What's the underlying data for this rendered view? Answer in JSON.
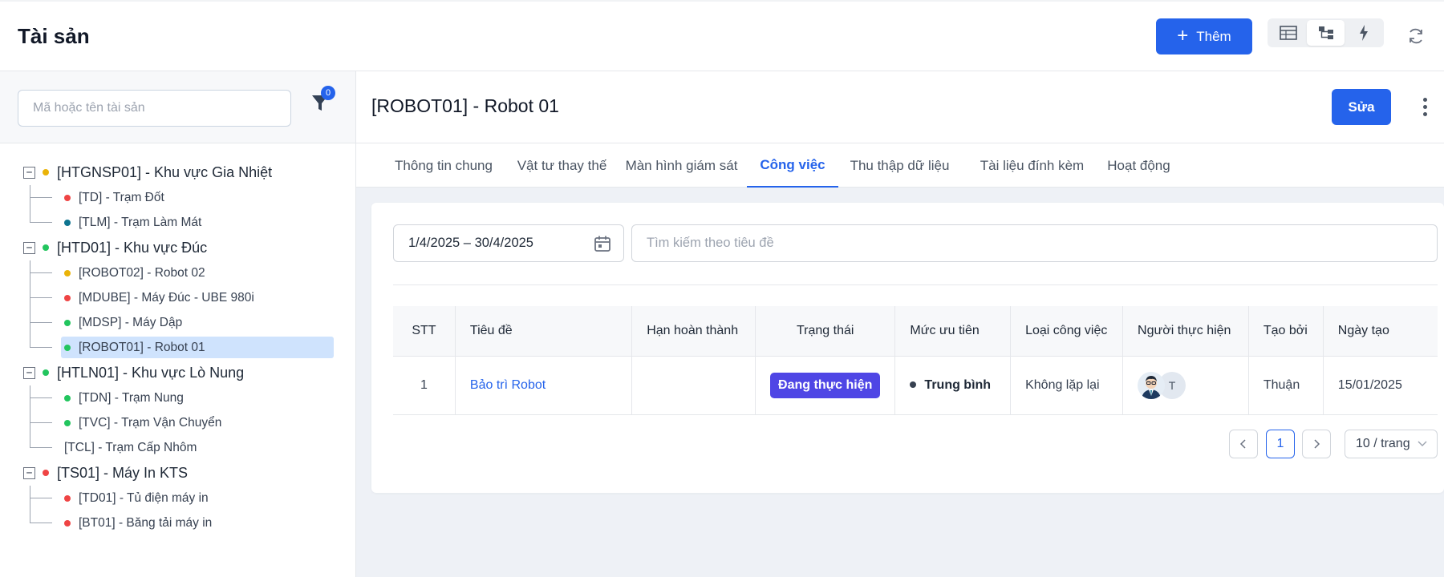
{
  "header": {
    "title": "Tài sản",
    "add_label": "Thêm",
    "view_modes": [
      "table-view-icon",
      "tree-view-icon",
      "lightning-icon"
    ]
  },
  "sidebar": {
    "search_placeholder": "Mã hoặc tên tài sản",
    "filter_count": "0",
    "tree": [
      {
        "label": "[HTGNSP01] - Khu vực Gia Nhiệt",
        "color": "#eab308",
        "children": [
          {
            "label": "[TD] - Trạm Đốt",
            "color": "#ef4444"
          },
          {
            "label": "[TLM] - Trạm Làm Mát",
            "color": "#0e7490"
          }
        ]
      },
      {
        "label": "[HTD01] - Khu vực Đúc",
        "color": "#22c55e",
        "children": [
          {
            "label": "[ROBOT02] - Robot 02",
            "color": "#eab308"
          },
          {
            "label": "[MDUBE] - Máy Đúc - UBE 980i",
            "color": "#ef4444"
          },
          {
            "label": "[MDSP] - Máy Dập",
            "color": "#22c55e"
          },
          {
            "label": "[ROBOT01] - Robot 01",
            "color": "#22c55e",
            "selected": true
          }
        ]
      },
      {
        "label": "[HTLN01] - Khu vực Lò Nung",
        "color": "#22c55e",
        "children": [
          {
            "label": "[TDN] - Trạm Nung",
            "color": "#22c55e"
          },
          {
            "label": "[TVC] - Trạm Vận Chuyển",
            "color": "#22c55e"
          },
          {
            "label": "[TCL] - Trạm Cấp Nhôm",
            "color": ""
          }
        ]
      },
      {
        "label": "[TS01] - Máy In KTS",
        "color": "#ef4444",
        "children": [
          {
            "label": "[TD01] - Tủ điện máy in",
            "color": "#ef4444"
          },
          {
            "label": "[BT01] - Băng tải máy in",
            "color": "#ef4444"
          }
        ]
      }
    ]
  },
  "detail": {
    "title": "[ROBOT01] - Robot 01",
    "edit_label": "Sửa",
    "tabs": [
      {
        "label": "Thông tin chung"
      },
      {
        "label": "Vật tư thay thế"
      },
      {
        "label": "Màn hình giám sát"
      },
      {
        "label": "Công việc",
        "active": true
      },
      {
        "label": "Thu thập dữ liệu"
      },
      {
        "label": "Tài liệu đính kèm"
      },
      {
        "label": "Hoạt động"
      }
    ]
  },
  "work": {
    "date_range": "1/4/2025 – 30/4/2025",
    "search_placeholder": "Tìm kiếm theo tiêu đề",
    "columns": [
      "STT",
      "Tiêu đề",
      "Hạn hoàn thành",
      "Trạng thái",
      "Mức ưu tiên",
      "Loại công việc",
      "Người thực hiện",
      "Tạo bởi",
      "Ngày tạo"
    ],
    "rows": [
      {
        "stt": "1",
        "title": "Bảo trì Robot",
        "deadline": "",
        "status": "Đang thực hiện",
        "priority": "Trung bình",
        "type": "Không lặp lại",
        "assignee_initial": "T",
        "created_by": "Thuận",
        "created_at": "15/01/2025"
      }
    ],
    "pagination": {
      "current": "1",
      "page_size": "10 / trang"
    }
  },
  "colors": {
    "primary": "#2563eb",
    "status": "#4f46e5"
  }
}
